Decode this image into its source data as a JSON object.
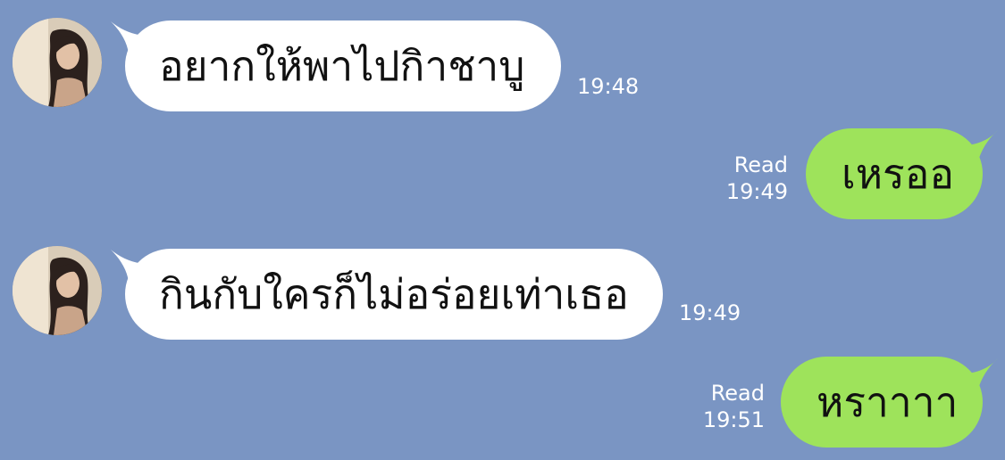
{
  "messages": [
    {
      "direction": "in",
      "text": "อยากให้พาไปกิาชาบู",
      "time": "19:48"
    },
    {
      "direction": "out",
      "text": "เหรออ",
      "status": "Read",
      "time": "19:49"
    },
    {
      "direction": "in",
      "text": "กินกับใครก็ไม่อร่อยเท่าเธอ",
      "time": "19:49"
    },
    {
      "direction": "out",
      "text": "หราาาา",
      "status": "Read",
      "time": "19:51"
    }
  ],
  "colors": {
    "background": "#7a95c3",
    "incoming_bubble": "#ffffff",
    "outgoing_bubble": "#9ee35b",
    "meta_text": "#ffffff"
  },
  "icons": {
    "avatar": "contact-avatar-photo"
  }
}
